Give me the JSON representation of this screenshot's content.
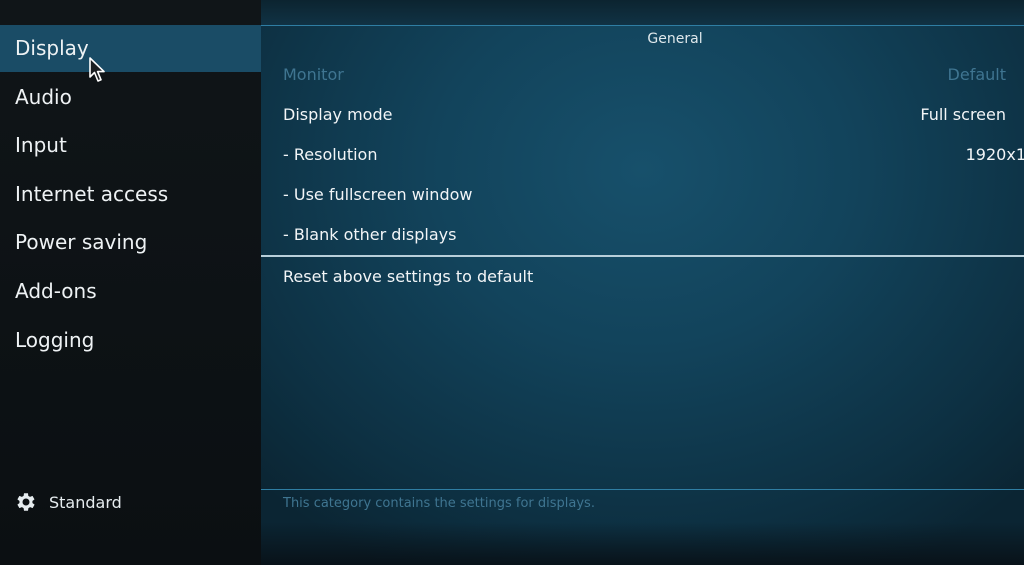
{
  "sidebar": {
    "items": [
      {
        "label": "Display",
        "active": true
      },
      {
        "label": "Audio",
        "active": false
      },
      {
        "label": "Input",
        "active": false
      },
      {
        "label": "Internet access",
        "active": false
      },
      {
        "label": "Power saving",
        "active": false
      },
      {
        "label": "Add-ons",
        "active": false
      },
      {
        "label": "Logging",
        "active": false
      }
    ],
    "footer": {
      "icon": "gear-icon",
      "label": "Standard"
    }
  },
  "main": {
    "section_title": "General",
    "settings": [
      {
        "label": "Monitor",
        "value": "Default",
        "disabled": true
      },
      {
        "label": "Display mode",
        "value": "Full screen",
        "disabled": false
      },
      {
        "label": "- Resolution",
        "value": "1920x1",
        "disabled": false
      },
      {
        "label": "- Use fullscreen window",
        "value": "",
        "disabled": false
      },
      {
        "label": "- Blank other displays",
        "value": "",
        "disabled": false
      }
    ],
    "reset_label": "Reset above settings to default",
    "description": "This category contains the settings for displays."
  },
  "colors": {
    "active_item": "#1a4c66",
    "accent_line": "#2f7ea3",
    "disabled_text": "#3f7591"
  }
}
